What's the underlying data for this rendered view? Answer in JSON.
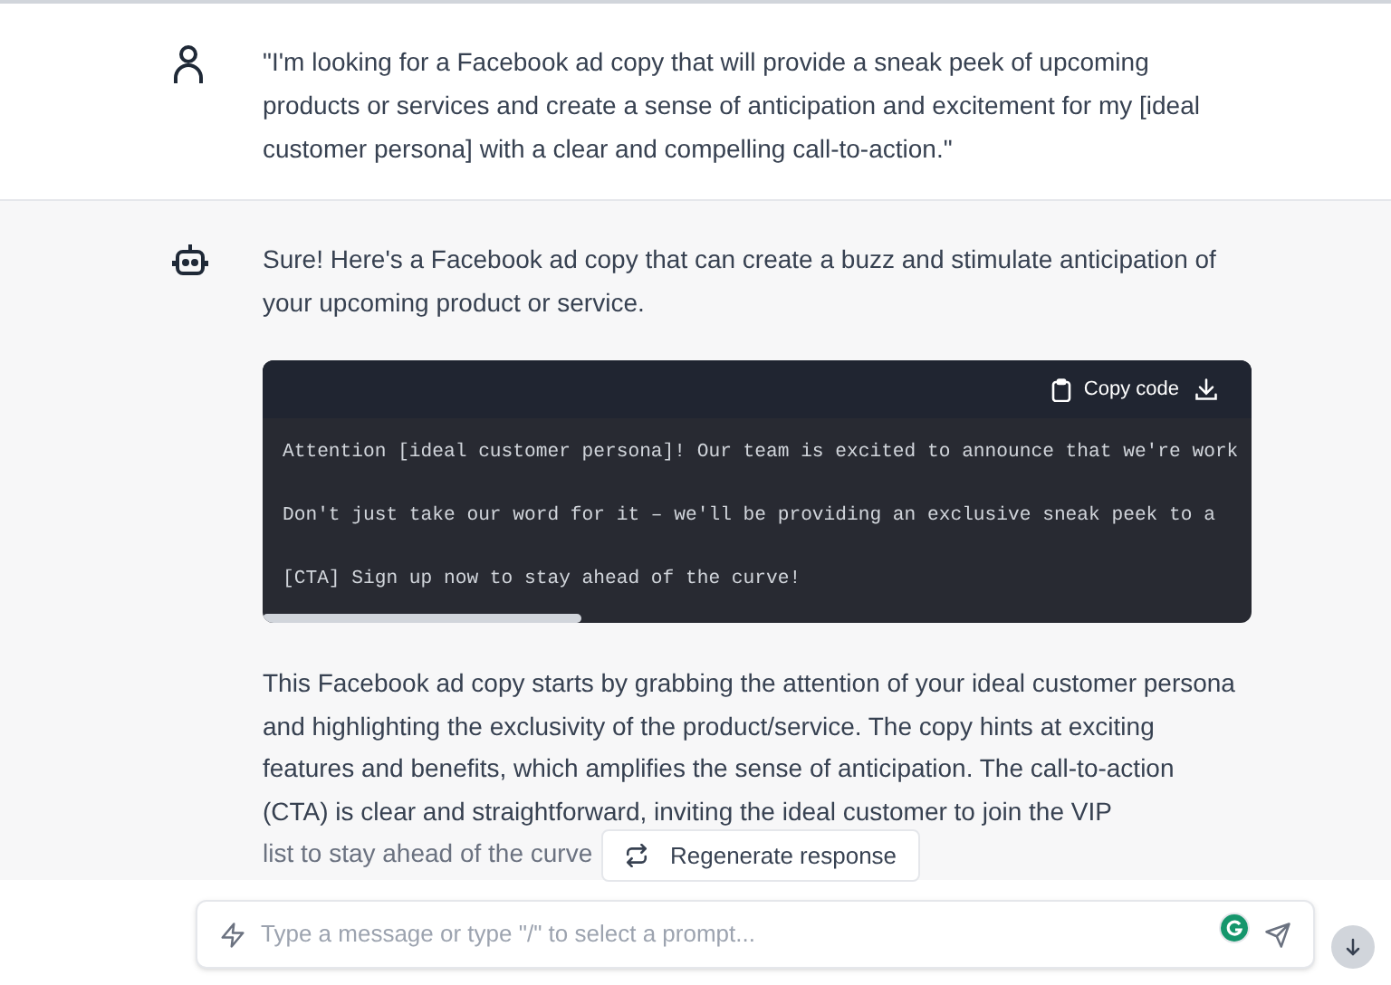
{
  "messages": [
    {
      "kind": "user",
      "text": "\"I'm looking for a Facebook ad copy that will provide a sneak peek of upcoming products or services and create a sense of anticipation and excitement for my [ideal customer persona] with a clear and compelling call-to-action.\""
    },
    {
      "kind": "bot",
      "intro": "Sure! Here's a Facebook ad copy that can create a buzz and stimulate anticipation of your upcoming product or service.",
      "code_block": {
        "copy_label": "Copy code",
        "lines": [
          "Attention [ideal customer persona]! Our team is excited to announce that we're work",
          "Don't just take our word for it – we'll be providing an exclusive sneak peek to a",
          "[CTA] Sign up now to stay ahead of the curve!"
        ]
      },
      "outro": "This Facebook ad copy starts by grabbing the attention of your ideal customer persona and highlighting the exclusivity of the product/service. The copy hints at exciting features and benefits, which amplifies the sense of anticipation. The call-to-action (CTA) is clear and straightforward, inviting the ideal customer to join the VIP",
      "outro_last_line": "list to stay ahead of the curve"
    }
  ],
  "regenerate_button": "Regenerate response",
  "composer": {
    "placeholder": "Type a message or type \"/\" to select a prompt..."
  }
}
